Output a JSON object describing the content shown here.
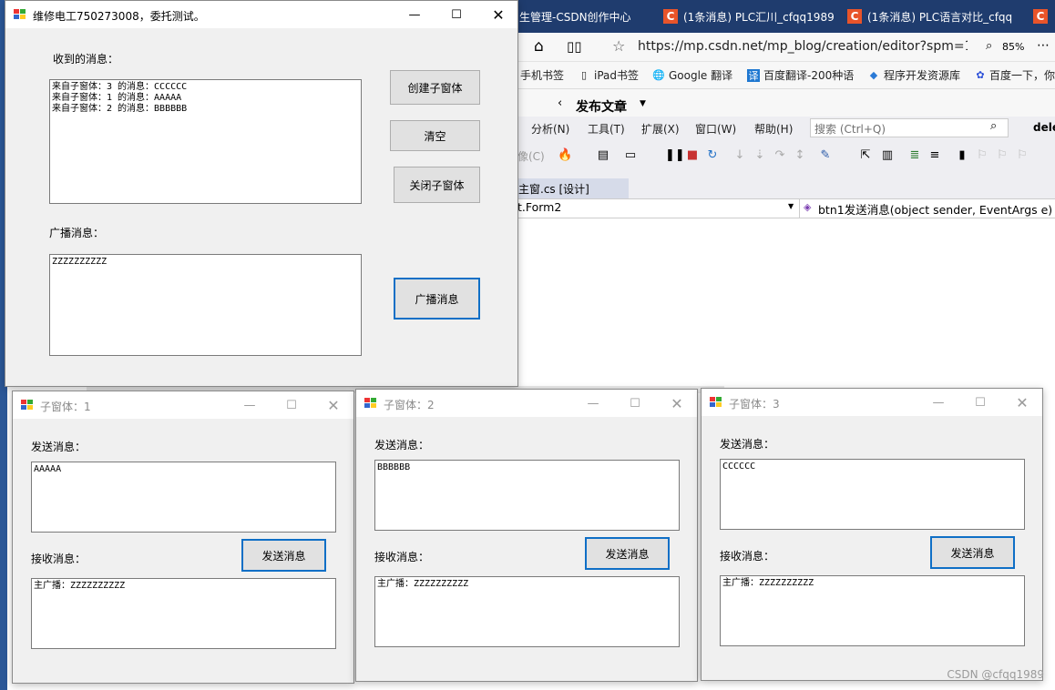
{
  "browser": {
    "tabs": [
      {
        "label": "生管理-CSDN创作中心"
      },
      {
        "label": "(1条消息) PLC汇川_cfqq1989"
      },
      {
        "label": "(1条消息) PLC语言对比_cfqq"
      },
      {
        "label": "C"
      }
    ],
    "url": "https://mp.csdn.net/mp_blog/creation/editor?spm=1(",
    "zoom": "85%",
    "bookmarks": [
      "手机书签",
      "iPad书签",
      "Google 翻译",
      "百度翻译-200种语",
      "程序开发资源库",
      "百度一下，你"
    ],
    "publish_label": "发布文章"
  },
  "ide": {
    "menus": [
      "分析(N)",
      "工具(T)",
      "扩展(X)",
      "窗口(W)",
      "帮助(H)"
    ],
    "search_placeholder": "搜索 (Ctrl+Q)",
    "user_label": "dele",
    "toolbar_text": "像(C)",
    "doc_tab": "主窗.cs [设计]",
    "nav_left": "t.Form2",
    "nav_right": "btn1发送消息(object sender, EventArgs e)"
  },
  "main_window": {
    "title": "维修电工750273008，委托测试。",
    "received_label": "收到的消息：",
    "received_text": "来自子窗体：3 的消息：CCCCCC\n来自子窗体：1 的消息：AAAAA\n来自子窗体：2 的消息：BBBBBB",
    "broadcast_label": "广播消息：",
    "broadcast_text": "ZZZZZZZZZZ",
    "buttons": {
      "create": "创建子窗体",
      "clear": "清空",
      "close_child": "关闭子窗体",
      "broadcast": "广播消息"
    }
  },
  "child_windows": [
    {
      "title": "子窗体：1",
      "send_label": "发送消息：",
      "send_text": "AAAAA",
      "recv_label": "接收消息：",
      "recv_text": "主广播：ZZZZZZZZZZ",
      "send_button": "发送消息"
    },
    {
      "title": "子窗体：2",
      "send_label": "发送消息：",
      "send_text": "BBBBBB",
      "recv_label": "接收消息：",
      "recv_text": "主广播：ZZZZZZZZZZ",
      "send_button": "发送消息"
    },
    {
      "title": "子窗体：3",
      "send_label": "发送消息：",
      "send_text": "CCCCCC",
      "recv_label": "接收消息：",
      "recv_text": "主广播：ZZZZZZZZZZ",
      "send_button": "发送消息"
    }
  ],
  "watermark": "CSDN @cfqq1989",
  "colors": {
    "accent_border": "#0f6fc6",
    "browser_tabbar": "#1f3c6e",
    "csdn_icon": "#e8542a"
  }
}
